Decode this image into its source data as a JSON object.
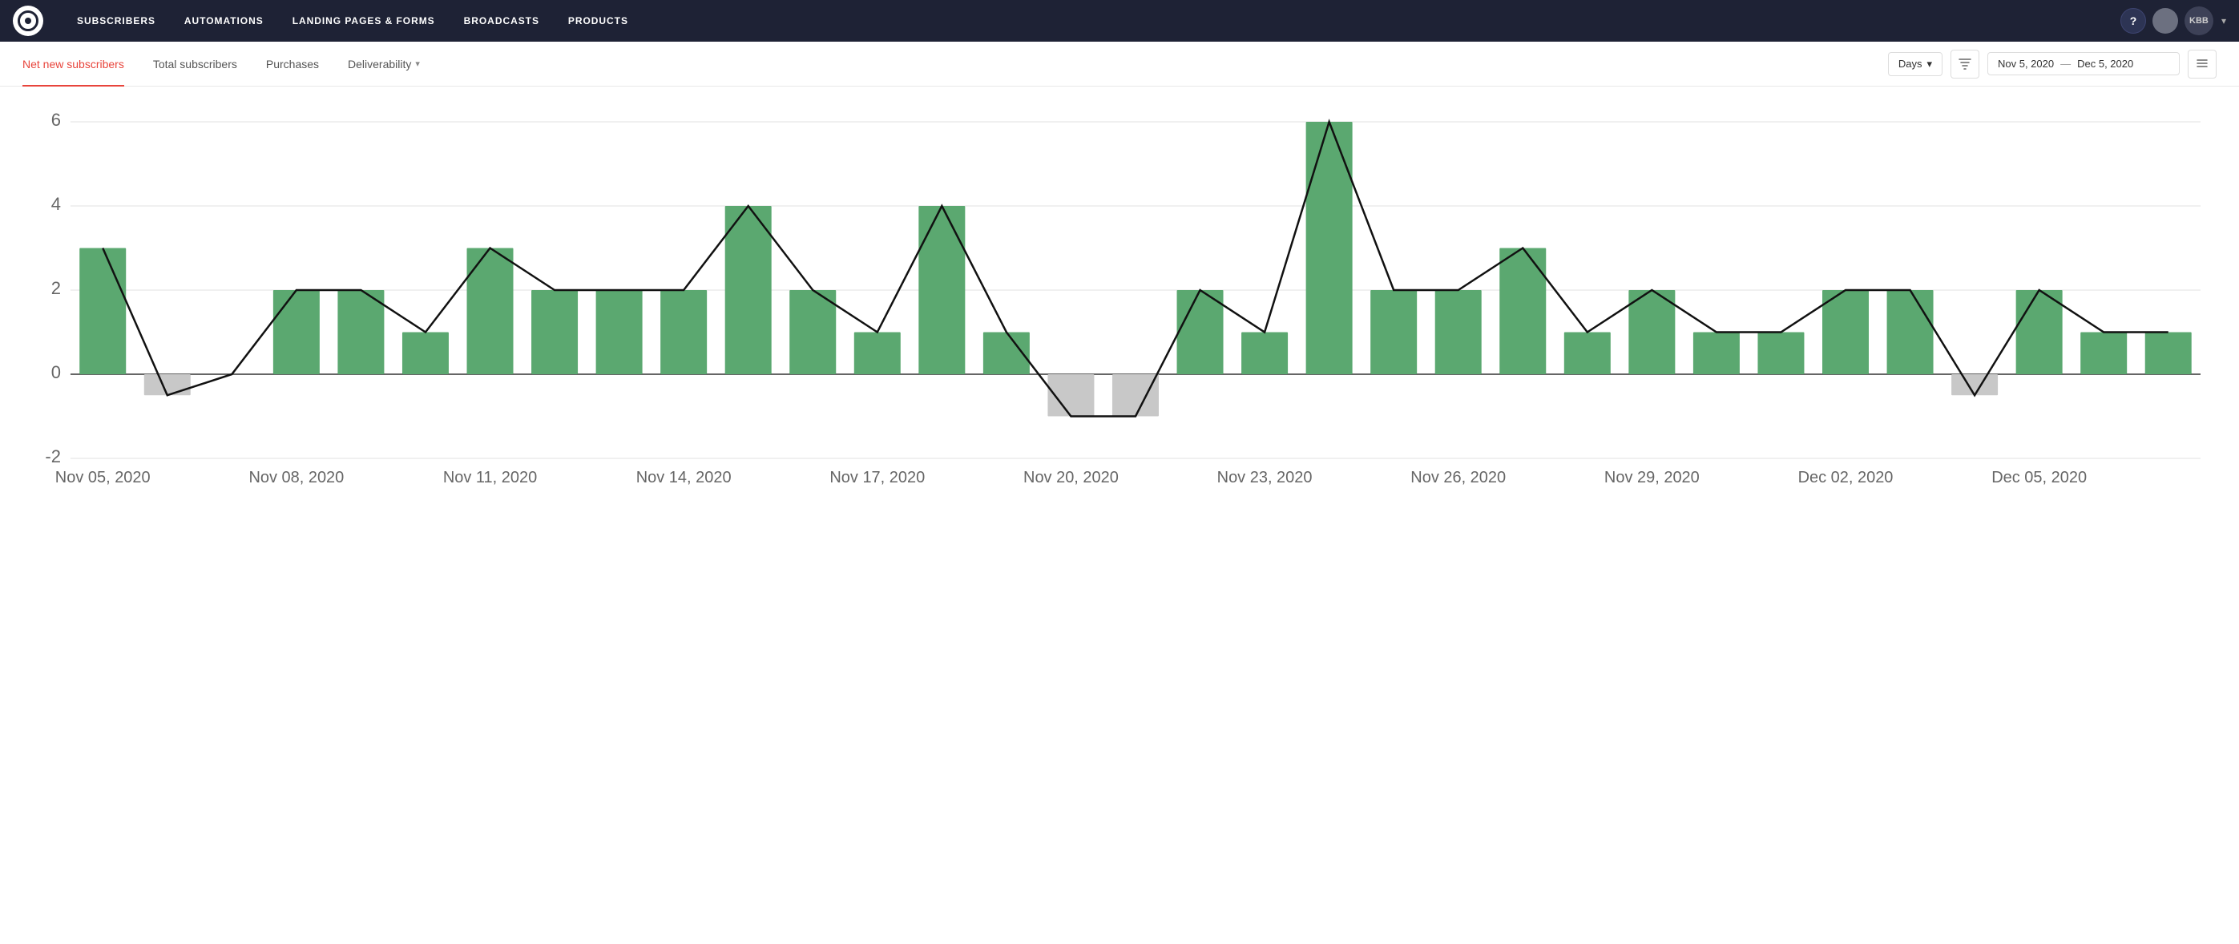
{
  "navbar": {
    "logo_alt": "ConvertKit",
    "items": [
      {
        "label": "SUBSCRIBERS",
        "active": true
      },
      {
        "label": "AUTOMATIONS",
        "active": false
      },
      {
        "label": "LANDING PAGES & FORMS",
        "active": false
      },
      {
        "label": "BROADCASTS",
        "active": false
      },
      {
        "label": "PRODUCTS",
        "active": false
      }
    ],
    "help_label": "?",
    "user_label": "KBB",
    "chevron": "▾"
  },
  "tabs": {
    "items": [
      {
        "label": "Net new subscribers",
        "active": true
      },
      {
        "label": "Total subscribers",
        "active": false
      },
      {
        "label": "Purchases",
        "active": false
      },
      {
        "label": "Deliverability",
        "active": false,
        "has_chevron": true
      }
    ],
    "controls": {
      "period": "Days",
      "date_start": "Nov 5, 2020",
      "date_sep": "—",
      "date_end": "Dec 5, 2020"
    }
  },
  "chart": {
    "y_labels": [
      "6",
      "4",
      "2",
      "0",
      "-2"
    ],
    "x_labels": [
      "Nov 05, 2020",
      "Nov 08, 2020",
      "Nov 11, 2020",
      "Nov 14, 2020",
      "Nov 17, 2020",
      "Nov 20, 2020",
      "Nov 23, 2020",
      "Nov 26, 2020",
      "Nov 29, 2020",
      "Dec 02, 2020",
      "Dec 05, 2020"
    ],
    "bars": [
      {
        "date": "Nov 05",
        "value": 3,
        "negative": false
      },
      {
        "date": "Nov 06",
        "value": -0.5,
        "negative": true
      },
      {
        "date": "Nov 07",
        "value": 0,
        "negative": false
      },
      {
        "date": "Nov 08",
        "value": 2,
        "negative": false
      },
      {
        "date": "Nov 09",
        "value": 2,
        "negative": false
      },
      {
        "date": "Nov 10",
        "value": 1,
        "negative": false
      },
      {
        "date": "Nov 11",
        "value": 3,
        "negative": false
      },
      {
        "date": "Nov 12",
        "value": 2,
        "negative": false
      },
      {
        "date": "Nov 13",
        "value": 2,
        "negative": false
      },
      {
        "date": "Nov 14",
        "value": 2,
        "negative": false
      },
      {
        "date": "Nov 15",
        "value": 4,
        "negative": false
      },
      {
        "date": "Nov 16",
        "value": 2,
        "negative": false
      },
      {
        "date": "Nov 17",
        "value": 1,
        "negative": false
      },
      {
        "date": "Nov 18",
        "value": 4,
        "negative": false
      },
      {
        "date": "Nov 19",
        "value": 1,
        "negative": false
      },
      {
        "date": "Nov 20",
        "value": -1,
        "negative": true
      },
      {
        "date": "Nov 21",
        "value": -1,
        "negative": true
      },
      {
        "date": "Nov 22",
        "value": 2,
        "negative": false
      },
      {
        "date": "Nov 23",
        "value": 1,
        "negative": false
      },
      {
        "date": "Nov 24",
        "value": 6,
        "negative": false
      },
      {
        "date": "Nov 25",
        "value": 2,
        "negative": false
      },
      {
        "date": "Nov 26",
        "value": 2,
        "negative": false
      },
      {
        "date": "Nov 27",
        "value": 3,
        "negative": false
      },
      {
        "date": "Nov 28",
        "value": 1,
        "negative": false
      },
      {
        "date": "Nov 29",
        "value": 2,
        "negative": false
      },
      {
        "date": "Nov 30",
        "value": 1,
        "negative": false
      },
      {
        "date": "Dec 01",
        "value": 1,
        "negative": false
      },
      {
        "date": "Dec 02",
        "value": 2,
        "negative": false
      },
      {
        "date": "Dec 03",
        "value": 2,
        "negative": false
      },
      {
        "date": "Dec 04",
        "value": -0.5,
        "negative": true
      },
      {
        "date": "Dec 05",
        "value": 2,
        "negative": false
      },
      {
        "date": "Dec 06",
        "value": 1,
        "negative": false
      },
      {
        "date": "Dec 07",
        "value": 1,
        "negative": false
      }
    ]
  }
}
